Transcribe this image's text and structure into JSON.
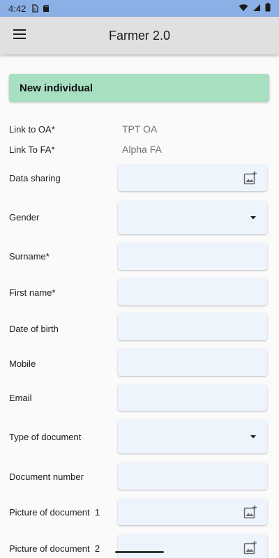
{
  "status_bar": {
    "time": "4:42",
    "icons": [
      "sim-icon",
      "sd-card-icon",
      "wifi-icon",
      "signal-icon",
      "battery-icon"
    ]
  },
  "app_bar": {
    "title": "Farmer 2.0",
    "menu_icon": "menu-icon"
  },
  "banner": {
    "text": "New individual"
  },
  "info_rows": [
    {
      "label": "Link to OA*",
      "value": "TPT OA"
    },
    {
      "label": "Link To FA*",
      "value": "Alpha FA"
    }
  ],
  "form_fields": [
    {
      "label": "Data sharing",
      "type": "image",
      "icon": "add-photo-icon"
    },
    {
      "label": "Gender",
      "type": "dropdown",
      "icon": "dropdown-arrow-icon"
    },
    {
      "label": "Surname*",
      "type": "text"
    },
    {
      "label": "First name*",
      "type": "text"
    },
    {
      "label": "Date of birth",
      "type": "text"
    },
    {
      "label": "Mobile",
      "type": "text"
    },
    {
      "label": "Email",
      "type": "text"
    },
    {
      "label": "Type of document",
      "type": "dropdown",
      "icon": "dropdown-arrow-icon"
    },
    {
      "label": "Document number",
      "type": "text"
    },
    {
      "label": "Picture of document  1",
      "type": "image",
      "icon": "add-photo-icon"
    },
    {
      "label": "Picture of document  2",
      "type": "image",
      "icon": "add-photo-icon"
    }
  ],
  "colors": {
    "status_bar": "#8ab0e6",
    "app_bar": "#e0e0e0",
    "banner": "#a8dfc1",
    "field_bg": "#eef4fc"
  }
}
